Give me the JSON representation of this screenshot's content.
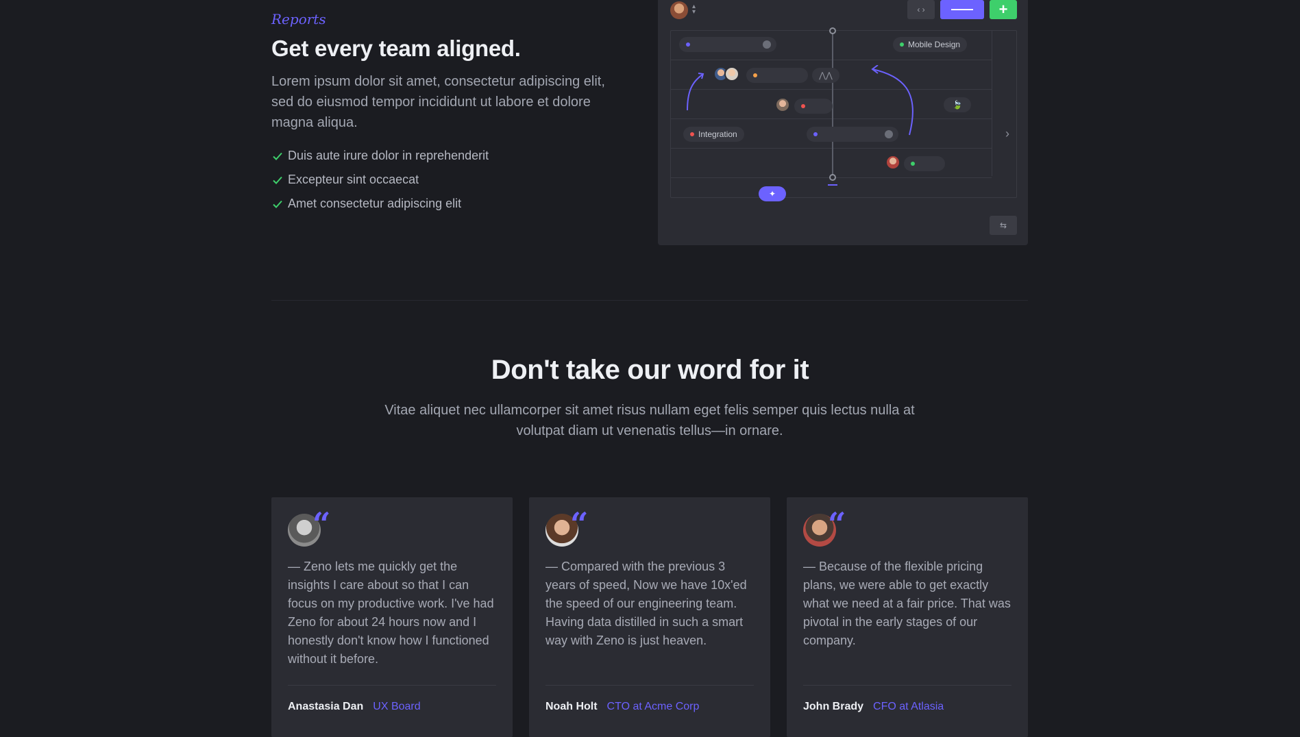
{
  "feature": {
    "eyebrow": "Reports",
    "title": "Get every team aligned.",
    "lead": "Lorem ipsum dolor sit amet, consectetur adipiscing elit, sed do eiusmod tempor incididunt ut labore et dolore magna aliqua.",
    "checks": [
      "Duis aute irure dolor in reprehenderit",
      "Excepteur sint occaecat",
      "Amet consectetur adipiscing elit"
    ]
  },
  "mock_app": {
    "code_btn_label": "‹ ›",
    "add_btn_label": "+",
    "pills": {
      "mobile_design": "Mobile Design",
      "integration": "Integration"
    },
    "colors": {
      "accent": "#6c62ff",
      "green": "#3ecf6b",
      "orange": "#f5a04a",
      "red": "#ef5350"
    }
  },
  "testimonials": {
    "heading": "Don't take our word for it",
    "subheading": "Vitae aliquet nec ullamcorper sit amet risus nullam eget felis semper quis lectus nulla at volutpat diam ut venenatis tellus—in ornare.",
    "cards": [
      {
        "quote": "— Zeno lets me quickly get the insights I care about so that I can focus on my productive work. I've had Zeno for about 24 hours now and I honestly don't know how I functioned without it before.",
        "name": "Anastasia Dan",
        "role": "UX Board"
      },
      {
        "quote": "— Compared with the previous 3 years of speed, Now we have 10x'ed the speed of our engineering team. Having data distilled in such a smart way with Zeno is just heaven.",
        "name": "Noah Holt",
        "role": "CTO at Acme Corp"
      },
      {
        "quote": "— Because of the flexible pricing plans, we were able to get exactly what we need at a fair price. That was pivotal in the early stages of our company.",
        "name": "John Brady",
        "role": "CFO at Atlasia"
      }
    ]
  }
}
